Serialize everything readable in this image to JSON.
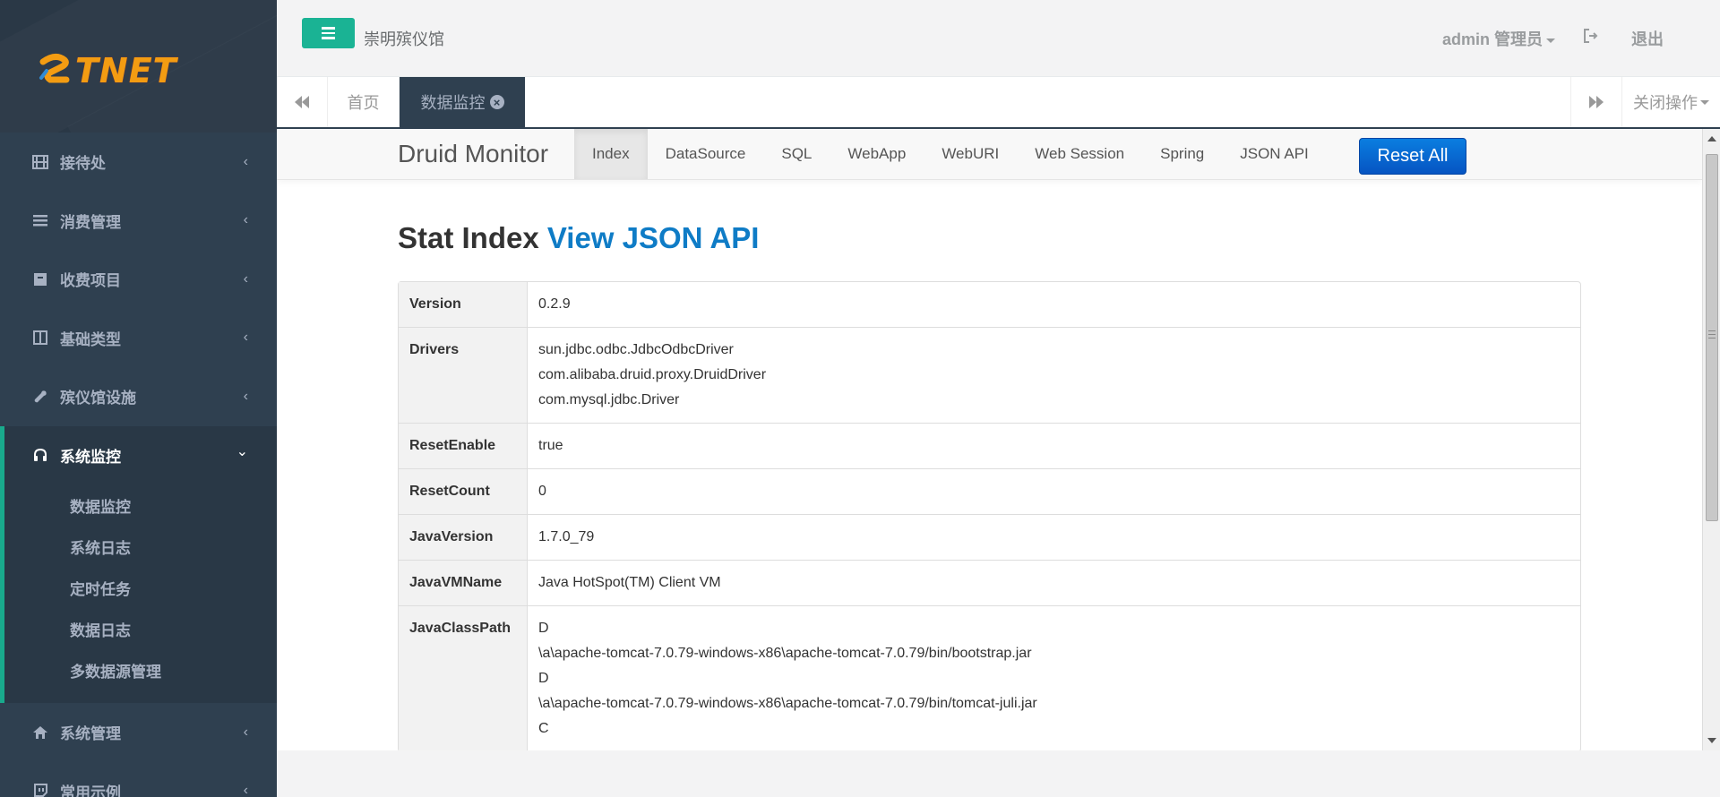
{
  "logo": {
    "text": "TNET"
  },
  "sidebar": {
    "items": [
      {
        "label": "接待处",
        "icon": "film-icon"
      },
      {
        "label": "消费管理",
        "icon": "list-icon"
      },
      {
        "label": "收费项目",
        "icon": "archive-icon"
      },
      {
        "label": "基础类型",
        "icon": "columns-icon"
      },
      {
        "label": "殡仪馆设施",
        "icon": "wrench-icon"
      }
    ],
    "active_group": {
      "label": "系统监控",
      "icon": "headphones-icon",
      "sub_items": [
        "数据监控",
        "系统日志",
        "定时任务",
        "数据日志",
        "多数据源管理"
      ]
    },
    "after_items": [
      {
        "label": "系统管理",
        "icon": "home-icon"
      },
      {
        "label": "常用示例",
        "icon": "twitch-icon"
      }
    ],
    "collapsed_arrow": "‹",
    "expanded_arrow": "⌄"
  },
  "header": {
    "hall_name": "崇明殡仪馆",
    "user": "admin 管理员",
    "logout": "退出"
  },
  "tabs": {
    "home": "首页",
    "active": "数据监控",
    "close_ops": "关闭操作"
  },
  "druid": {
    "brand": "Druid Monitor",
    "nav": [
      "Index",
      "DataSource",
      "SQL",
      "WebApp",
      "WebURI",
      "Web Session",
      "Spring",
      "JSON API"
    ],
    "reset": "Reset All",
    "heading": "Stat Index",
    "heading_link": "View JSON API",
    "rows": [
      {
        "key": "Version",
        "values": [
          "0.2.9"
        ]
      },
      {
        "key": "Drivers",
        "values": [
          "sun.jdbc.odbc.JdbcOdbcDriver",
          "com.alibaba.druid.proxy.DruidDriver",
          "com.mysql.jdbc.Driver"
        ]
      },
      {
        "key": "ResetEnable",
        "values": [
          "true"
        ]
      },
      {
        "key": "ResetCount",
        "values": [
          "0"
        ]
      },
      {
        "key": "JavaVersion",
        "values": [
          "1.7.0_79"
        ]
      },
      {
        "key": "JavaVMName",
        "values": [
          "Java HotSpot(TM) Client VM"
        ]
      },
      {
        "key": "JavaClassPath",
        "values": [
          "D",
          "\\a\\apache-tomcat-7.0.79-windows-x86\\apache-tomcat-7.0.79/bin/bootstrap.jar",
          "D",
          "\\a\\apache-tomcat-7.0.79-windows-x86\\apache-tomcat-7.0.79/bin/tomcat-juli.jar",
          "C"
        ]
      }
    ]
  },
  "colors": {
    "sidebar": "#2f4050",
    "accent": "#1ab394",
    "link": "#0f7cc6",
    "reset": "#0654c2"
  }
}
